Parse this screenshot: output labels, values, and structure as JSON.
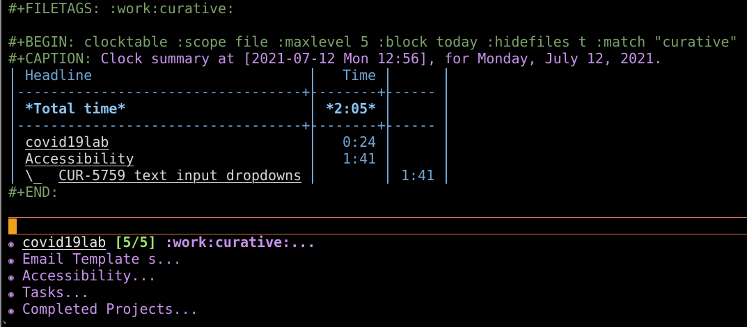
{
  "filetags_line": "#+FILETAGS: :work:curative:",
  "begin_line": "#+BEGIN: clocktable :scope file :maxlevel 5 :block today :hidefiles t :match \"curative\" :",
  "caption": {
    "keyword": "#+CAPTION:",
    "text": " Clock summary at [2021-07-12 Mon 12:56], for Monday, July 12, 2021."
  },
  "table": {
    "header_headline": "Headline",
    "header_time": "Time",
    "separator": "----------------------------------+--------+------",
    "total_label": "*Total time*",
    "total_time": "*2:05*",
    "rows": [
      {
        "indent": "",
        "headline": "covid19lab",
        "time": "0:24",
        "sub_time": ""
      },
      {
        "indent": "",
        "headline": "Accessibility",
        "time": "1:41",
        "sub_time": ""
      },
      {
        "indent": "\\_  ",
        "headline": "CUR-5759 text input dropdowns",
        "time": "",
        "sub_time": "1:41"
      }
    ]
  },
  "end_line": "#+END:",
  "headings": [
    {
      "bullet": "◉",
      "title": "covid19lab",
      "cookie": "[5/5]",
      "tags": ":work:curative:..."
    },
    {
      "bullet": "◉",
      "title": "Email Template s..."
    },
    {
      "bullet": "◉",
      "title": "Accessibility..."
    },
    {
      "bullet": "◉",
      "title": "Tasks..."
    },
    {
      "bullet": "◉",
      "title": "Completed Projects..."
    }
  ],
  "colors": {
    "keyword": "#7aa069",
    "caption": "#c792ea",
    "table": "#6fa4d3",
    "separator": "#e0784c",
    "cursor": "#f0a020",
    "cookie": "#9be36a"
  },
  "corner_glyph": "↘"
}
